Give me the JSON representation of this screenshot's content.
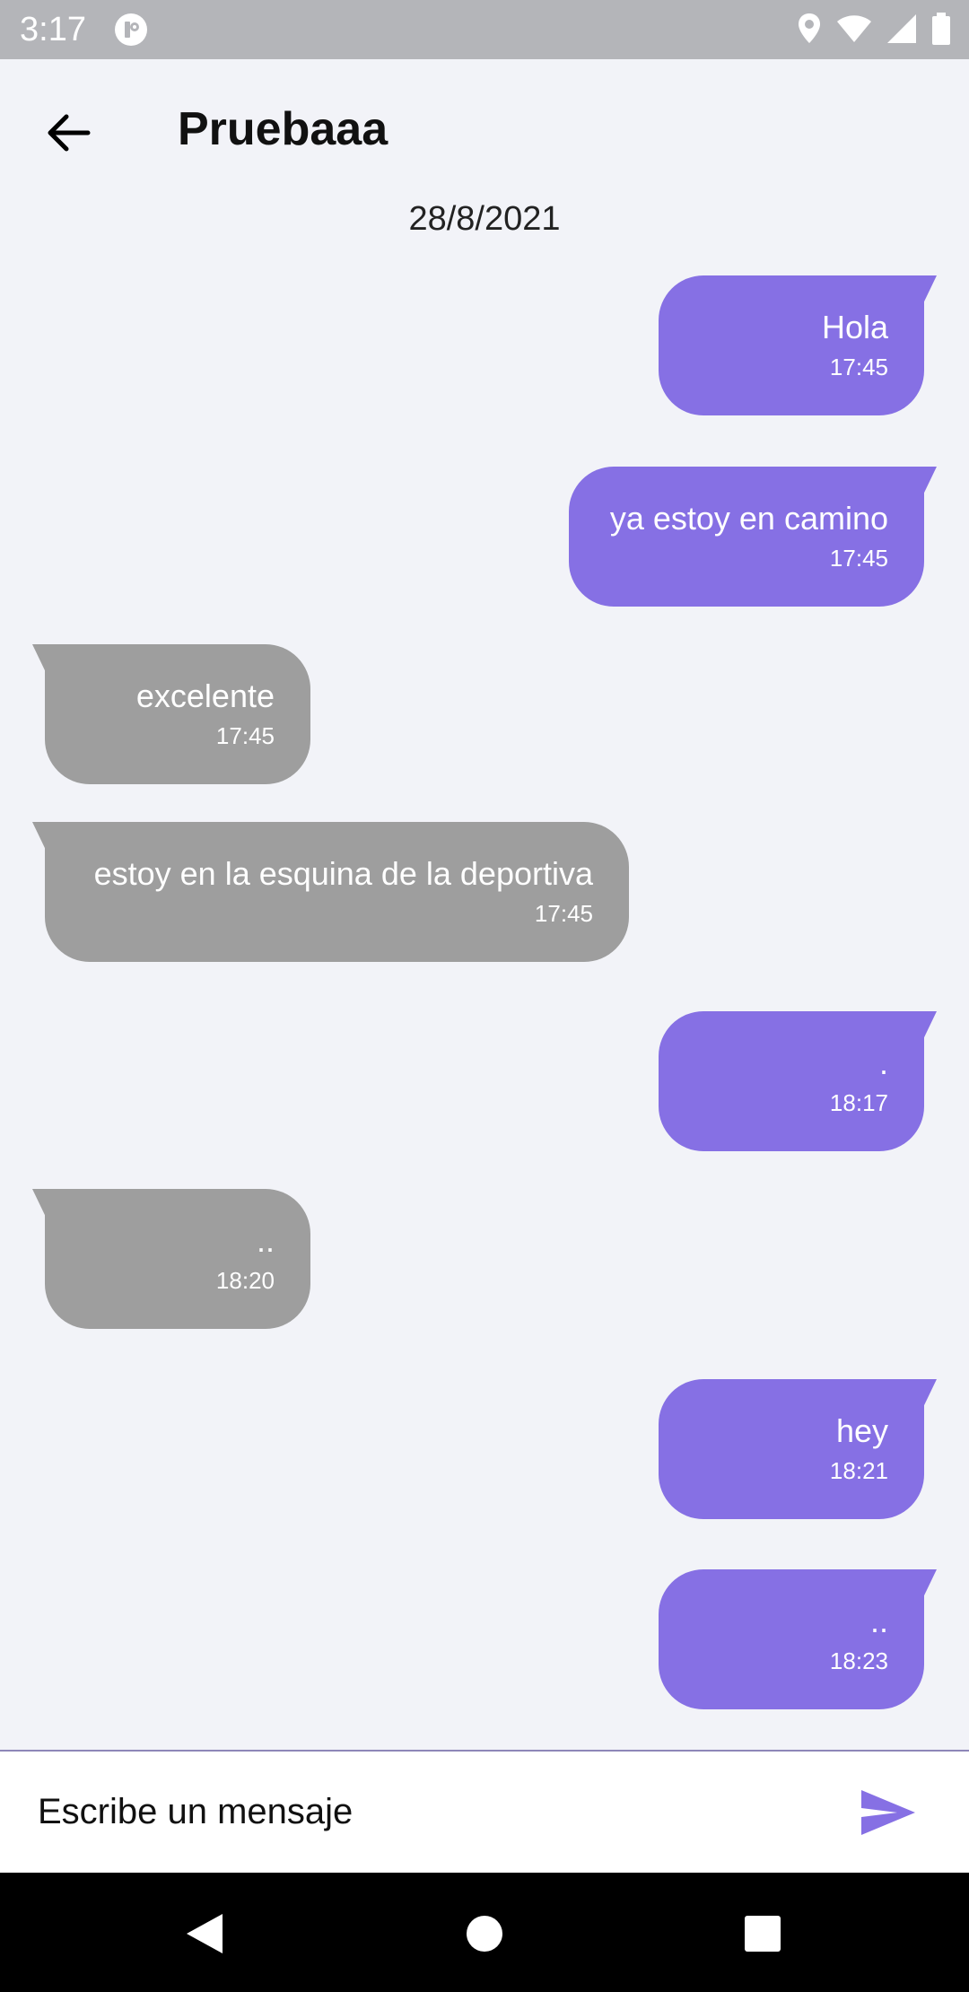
{
  "status_bar": {
    "time": "3:17",
    "icons": [
      "app-notification-icon",
      "location-icon",
      "wifi-icon",
      "signal-icon",
      "battery-icon"
    ]
  },
  "header": {
    "title": "Pruebaaa",
    "back_icon": "arrow-left-icon"
  },
  "date_label": "28/8/2021",
  "messages": [
    {
      "direction": "out",
      "text": "Hola",
      "time": "17:45"
    },
    {
      "direction": "out",
      "text": "ya estoy en camino",
      "time": "17:45"
    },
    {
      "direction": "in",
      "text": "excelente",
      "time": "17:45"
    },
    {
      "direction": "in",
      "text": "estoy en la esquina de la deportiva",
      "time": "17:45"
    },
    {
      "direction": "out",
      "text": ".",
      "time": "18:17"
    },
    {
      "direction": "in",
      "text": "..",
      "time": "18:20"
    },
    {
      "direction": "out",
      "text": "hey",
      "time": "18:21"
    },
    {
      "direction": "out",
      "text": "..",
      "time": "18:23"
    }
  ],
  "composer": {
    "placeholder": "Escribe un mensaje",
    "value": "",
    "send_icon": "send-icon"
  },
  "colors": {
    "outgoing_bubble": "#8670e4",
    "incoming_bubble": "#9e9e9e",
    "background": "#f2f3f8",
    "send_icon": "#8670e4"
  },
  "nav_bar": {
    "icons": [
      "back-triangle-icon",
      "home-circle-icon",
      "recents-square-icon"
    ]
  }
}
